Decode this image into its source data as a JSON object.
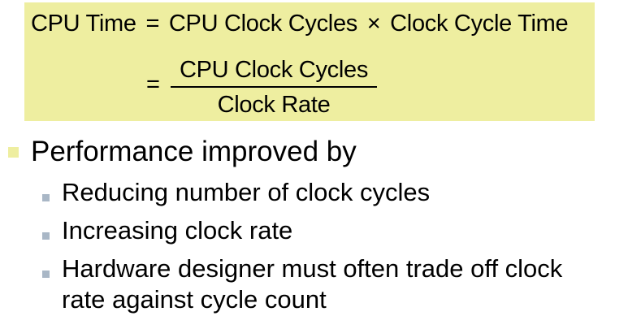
{
  "formula": {
    "line1": {
      "lhs": "CPU Time",
      "eq": "=",
      "term1": "CPU Clock Cycles",
      "times": "×",
      "term2": "Clock Cycle Time"
    },
    "line2": {
      "eq": "=",
      "numerator": "CPU Clock Cycles",
      "denominator": "Clock Rate"
    }
  },
  "heading": "Performance improved by",
  "bullets": [
    "Reducing number of clock cycles",
    "Increasing clock rate",
    "Hardware designer must often trade off clock",
    "rate against cycle count"
  ],
  "colors": {
    "formula_background": "#eeeea0",
    "main_bullet": "#eeeea0",
    "sub_bullet": "#a9b7c6"
  }
}
